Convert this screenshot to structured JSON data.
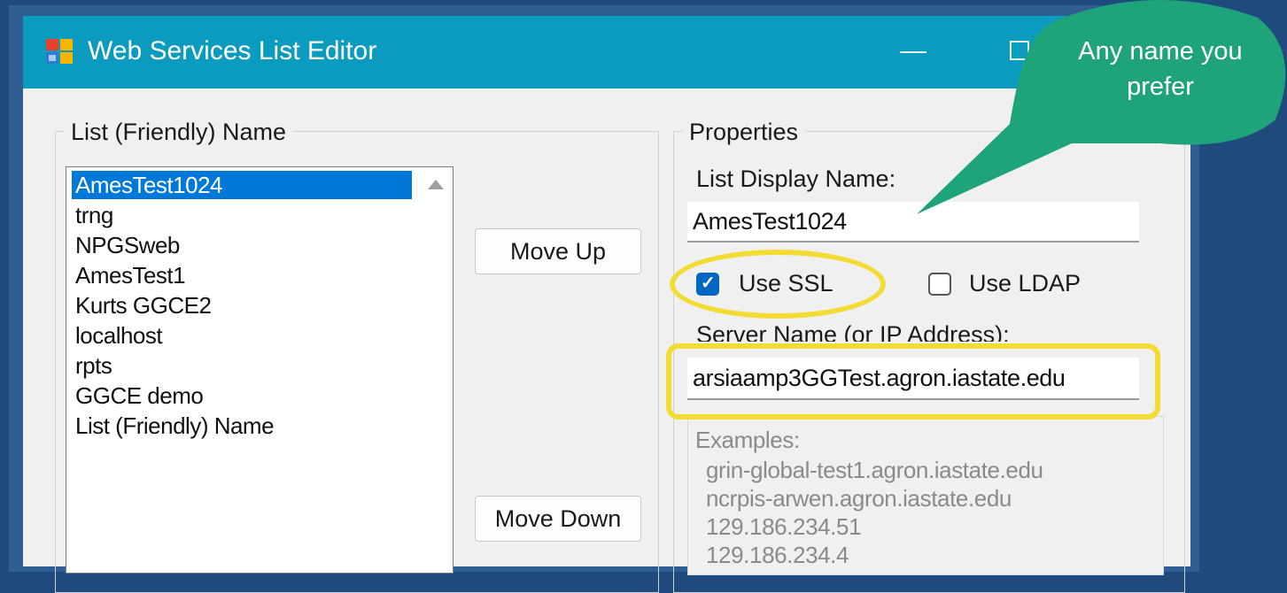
{
  "window": {
    "title": "Web Services List Editor"
  },
  "list_group": {
    "legend": "List (Friendly) Name",
    "items": [
      {
        "label": "AmesTest1024",
        "selected": true
      },
      {
        "label": "trng",
        "selected": false
      },
      {
        "label": "NPGSweb",
        "selected": false
      },
      {
        "label": "AmesTest1",
        "selected": false
      },
      {
        "label": "Kurts GGCE2",
        "selected": false
      },
      {
        "label": "localhost",
        "selected": false
      },
      {
        "label": "rpts",
        "selected": false
      },
      {
        "label": "GGCE demo",
        "selected": false
      },
      {
        "label": "List (Friendly) Name",
        "selected": false
      }
    ]
  },
  "buttons": {
    "move_up": "Move Up",
    "move_down": "Move Down"
  },
  "properties": {
    "legend": "Properties",
    "display_name_label": "List Display Name:",
    "display_name_value": "AmesTest1024",
    "use_ssl_label": "Use SSL",
    "use_ssl_checked": true,
    "use_ldap_label": "Use LDAP",
    "use_ldap_checked": false,
    "server_name_label": "Server Name (or IP Address):",
    "server_name_value": "arsiaamp3GGTest.agron.iastate.edu",
    "examples_title": "Examples:",
    "examples": [
      "grin-global-test1.agron.iastate.edu",
      "ncrpis-arwen.agron.iastate.edu",
      "129.186.234.51",
      "129.186.234.4"
    ]
  },
  "callout": {
    "text_line1": "Any name you",
    "text_line2": "prefer"
  },
  "colors": {
    "titlebar": "#0a9bbf",
    "highlight": "#f2dc33",
    "callout": "#1fa37a",
    "selection": "#0078d7"
  }
}
